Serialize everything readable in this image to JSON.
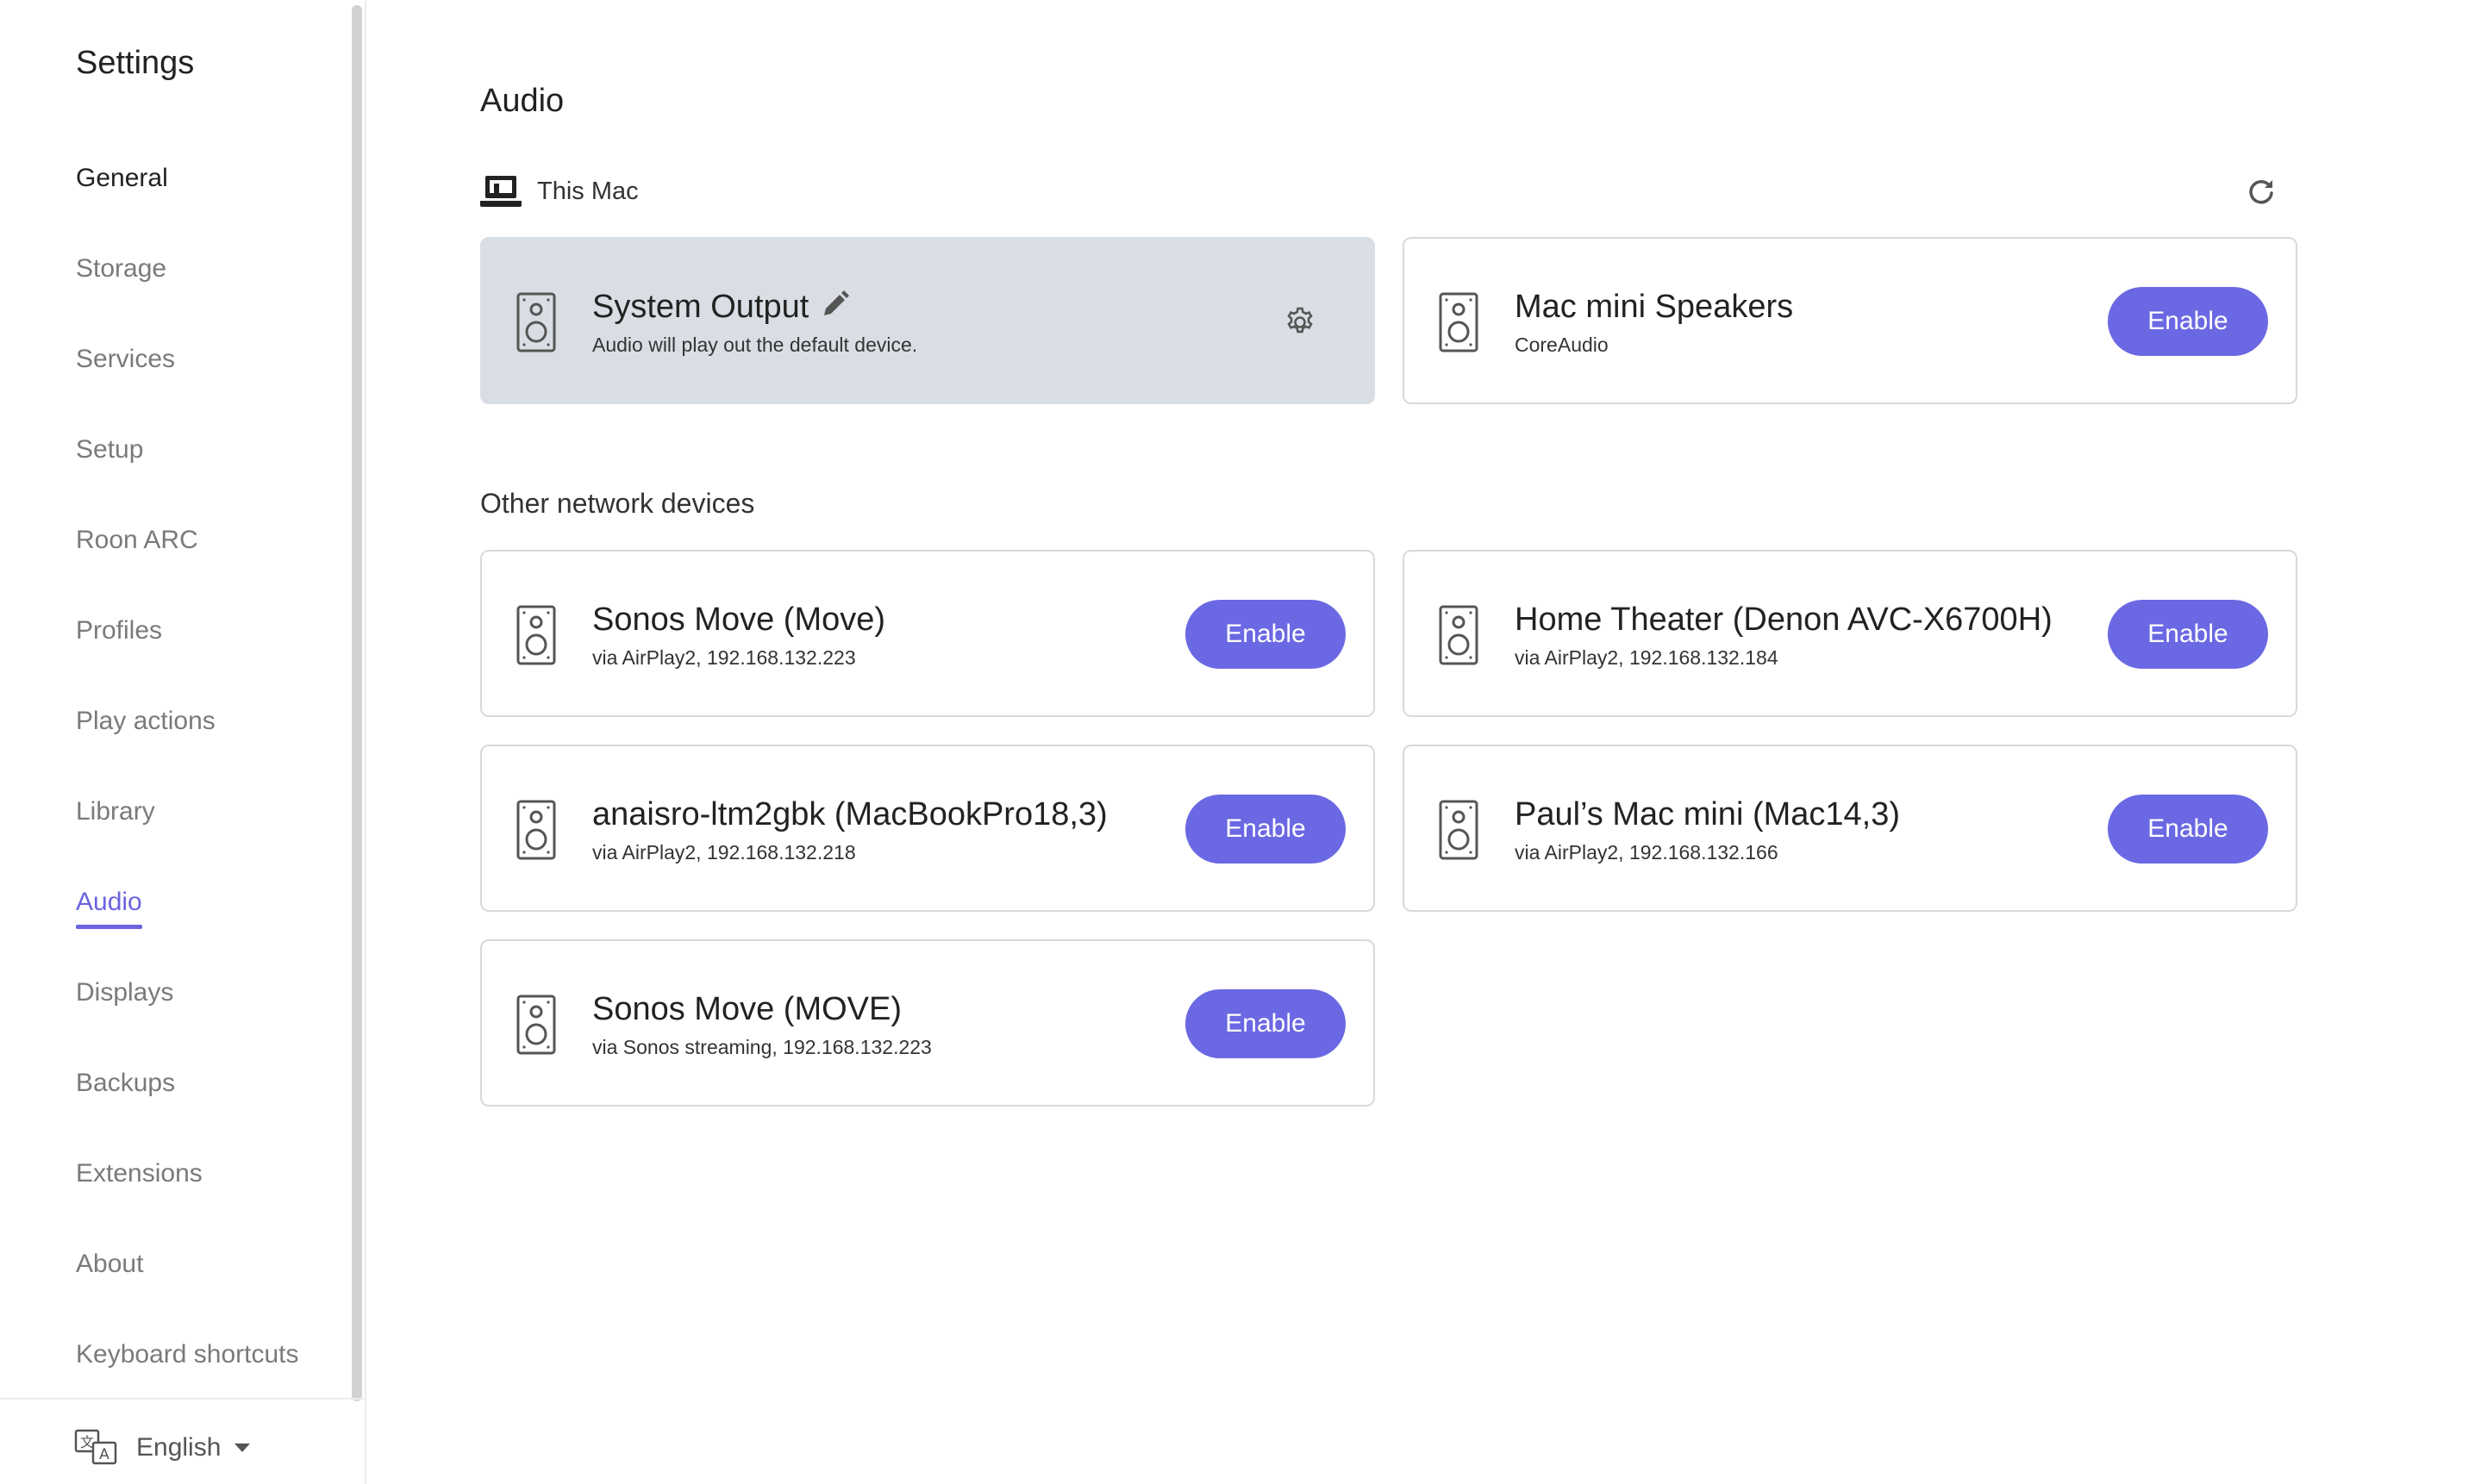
{
  "sidebar": {
    "title": "Settings",
    "items": [
      {
        "label": "General"
      },
      {
        "label": "Storage"
      },
      {
        "label": "Services"
      },
      {
        "label": "Setup"
      },
      {
        "label": "Roon ARC"
      },
      {
        "label": "Profiles"
      },
      {
        "label": "Play actions"
      },
      {
        "label": "Library"
      },
      {
        "label": "Audio"
      },
      {
        "label": "Displays"
      },
      {
        "label": "Backups"
      },
      {
        "label": "Extensions"
      },
      {
        "label": "About"
      },
      {
        "label": "Keyboard shortcuts"
      }
    ],
    "active": "Audio",
    "language": {
      "label": "English",
      "icon": "translate-icon"
    }
  },
  "main": {
    "title": "Audio",
    "this_mac": {
      "label": "This Mac",
      "icon": "laptop-icon",
      "refresh_icon": "refresh-icon",
      "devices": [
        {
          "name": "System Output",
          "sub": "Audio will play out the default device.",
          "selected": true,
          "icons": [
            "pencil-icon",
            "gear-icon"
          ]
        },
        {
          "name": "Mac mini Speakers",
          "sub": "CoreAudio",
          "button": "Enable"
        }
      ]
    },
    "other": {
      "label": "Other network devices",
      "devices": [
        {
          "name": "Sonos Move (Move)",
          "sub": "via AirPlay2, 192.168.132.223",
          "button": "Enable"
        },
        {
          "name": "Home Theater (Denon AVC-X6700H)",
          "sub": "via AirPlay2, 192.168.132.184",
          "button": "Enable"
        },
        {
          "name": "anaisro-ltm2gbk (MacBookPro18,3)",
          "sub": "via AirPlay2, 192.168.132.218",
          "button": "Enable"
        },
        {
          "name": "Paul’s Mac mini (Mac14,3)",
          "sub": "via AirPlay2, 192.168.132.166",
          "button": "Enable"
        },
        {
          "name": "Sonos Move (MOVE)",
          "sub": "via Sonos streaming, 192.168.132.223",
          "button": "Enable"
        }
      ]
    }
  },
  "colors": {
    "accent": "#6b68e3",
    "active_nav": "#6b63e0",
    "selected_card": "#d9dee5"
  }
}
